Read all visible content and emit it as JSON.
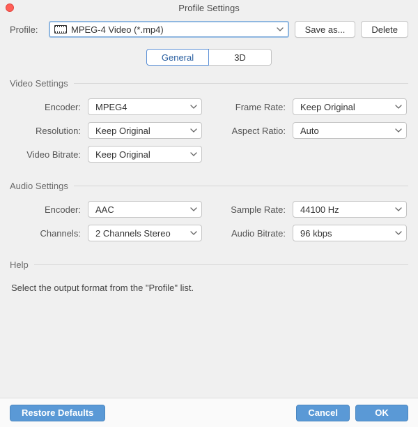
{
  "window": {
    "title": "Profile Settings"
  },
  "profile": {
    "label": "Profile:",
    "selected": "MPEG-4 Video (*.mp4)",
    "save_as_label": "Save as...",
    "delete_label": "Delete"
  },
  "tabs": {
    "general": "General",
    "threeD": "3D"
  },
  "video": {
    "legend": "Video Settings",
    "encoder": {
      "label": "Encoder:",
      "value": "MPEG4"
    },
    "resolution": {
      "label": "Resolution:",
      "value": "Keep Original"
    },
    "video_bitrate": {
      "label": "Video Bitrate:",
      "value": "Keep Original"
    },
    "frame_rate": {
      "label": "Frame Rate:",
      "value": "Keep Original"
    },
    "aspect_ratio": {
      "label": "Aspect Ratio:",
      "value": "Auto"
    }
  },
  "audio": {
    "legend": "Audio Settings",
    "encoder": {
      "label": "Encoder:",
      "value": "AAC"
    },
    "channels": {
      "label": "Channels:",
      "value": "2 Channels Stereo"
    },
    "sample_rate": {
      "label": "Sample Rate:",
      "value": "44100 Hz"
    },
    "audio_bitrate": {
      "label": "Audio Bitrate:",
      "value": "96 kbps"
    }
  },
  "help": {
    "legend": "Help",
    "text": "Select the output format from the \"Profile\" list."
  },
  "footer": {
    "restore": "Restore Defaults",
    "cancel": "Cancel",
    "ok": "OK"
  }
}
